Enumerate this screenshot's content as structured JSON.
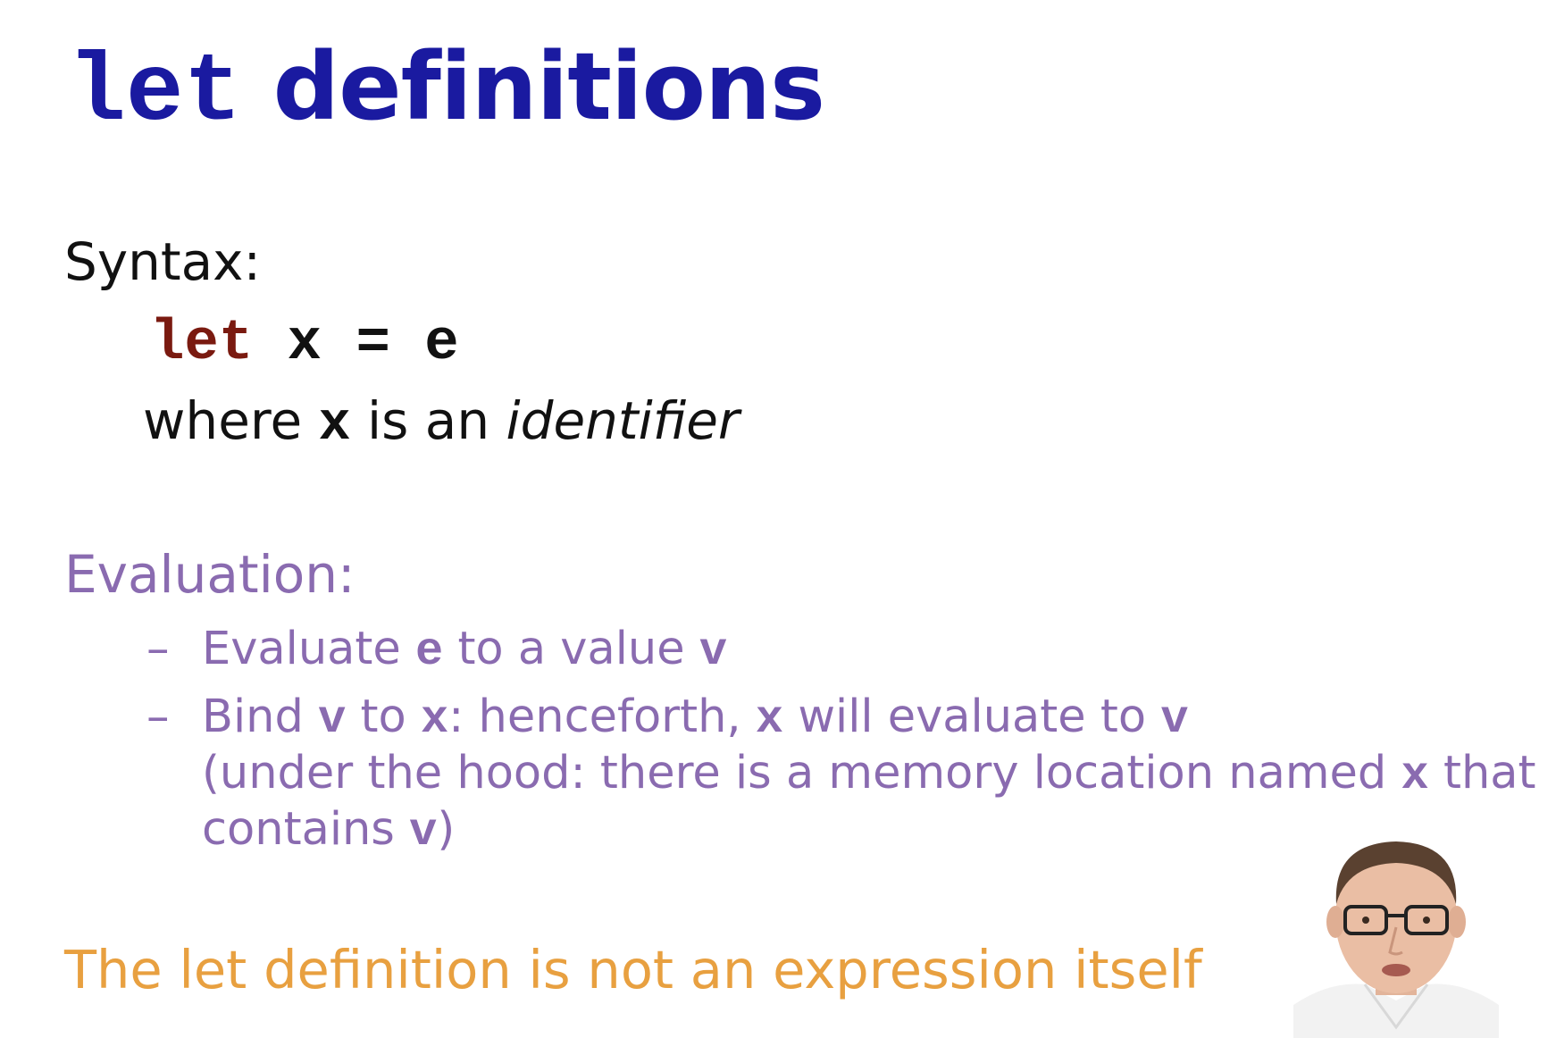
{
  "title": {
    "keyword": "let",
    "rest": "definitions"
  },
  "syntax": {
    "heading": "Syntax:",
    "code": {
      "kw": "let",
      "var": "x",
      "eq": "=",
      "expr": "e"
    },
    "note": {
      "prefix": "where",
      "var": "x",
      "middle": "is an",
      "term": "identifier"
    }
  },
  "evaluation": {
    "heading": "Evaluation:",
    "bullets": [
      {
        "dash": "–",
        "t1": "Evaluate",
        "c1": "e",
        "t2": "to a value",
        "c2": "v"
      },
      {
        "dash": "–",
        "t1": "Bind",
        "c1": "v",
        "t2": "to",
        "c2": "x",
        "t3": ": henceforth,",
        "c3": "x",
        "t4": "will evaluate to",
        "c4": "v",
        "line2a": "(under the hood: there is a memory location named",
        "line2c": "x",
        "line2b": "that",
        "line3a": "contains",
        "line3c": "v",
        "line3b": ")"
      }
    ]
  },
  "footer": {
    "note": "The let definition is not an expression itself"
  },
  "colors": {
    "title": "#1a1aa0",
    "keyword": "#7a1a10",
    "evaluation": "#8a6bb0",
    "footer": "#e8a040"
  }
}
